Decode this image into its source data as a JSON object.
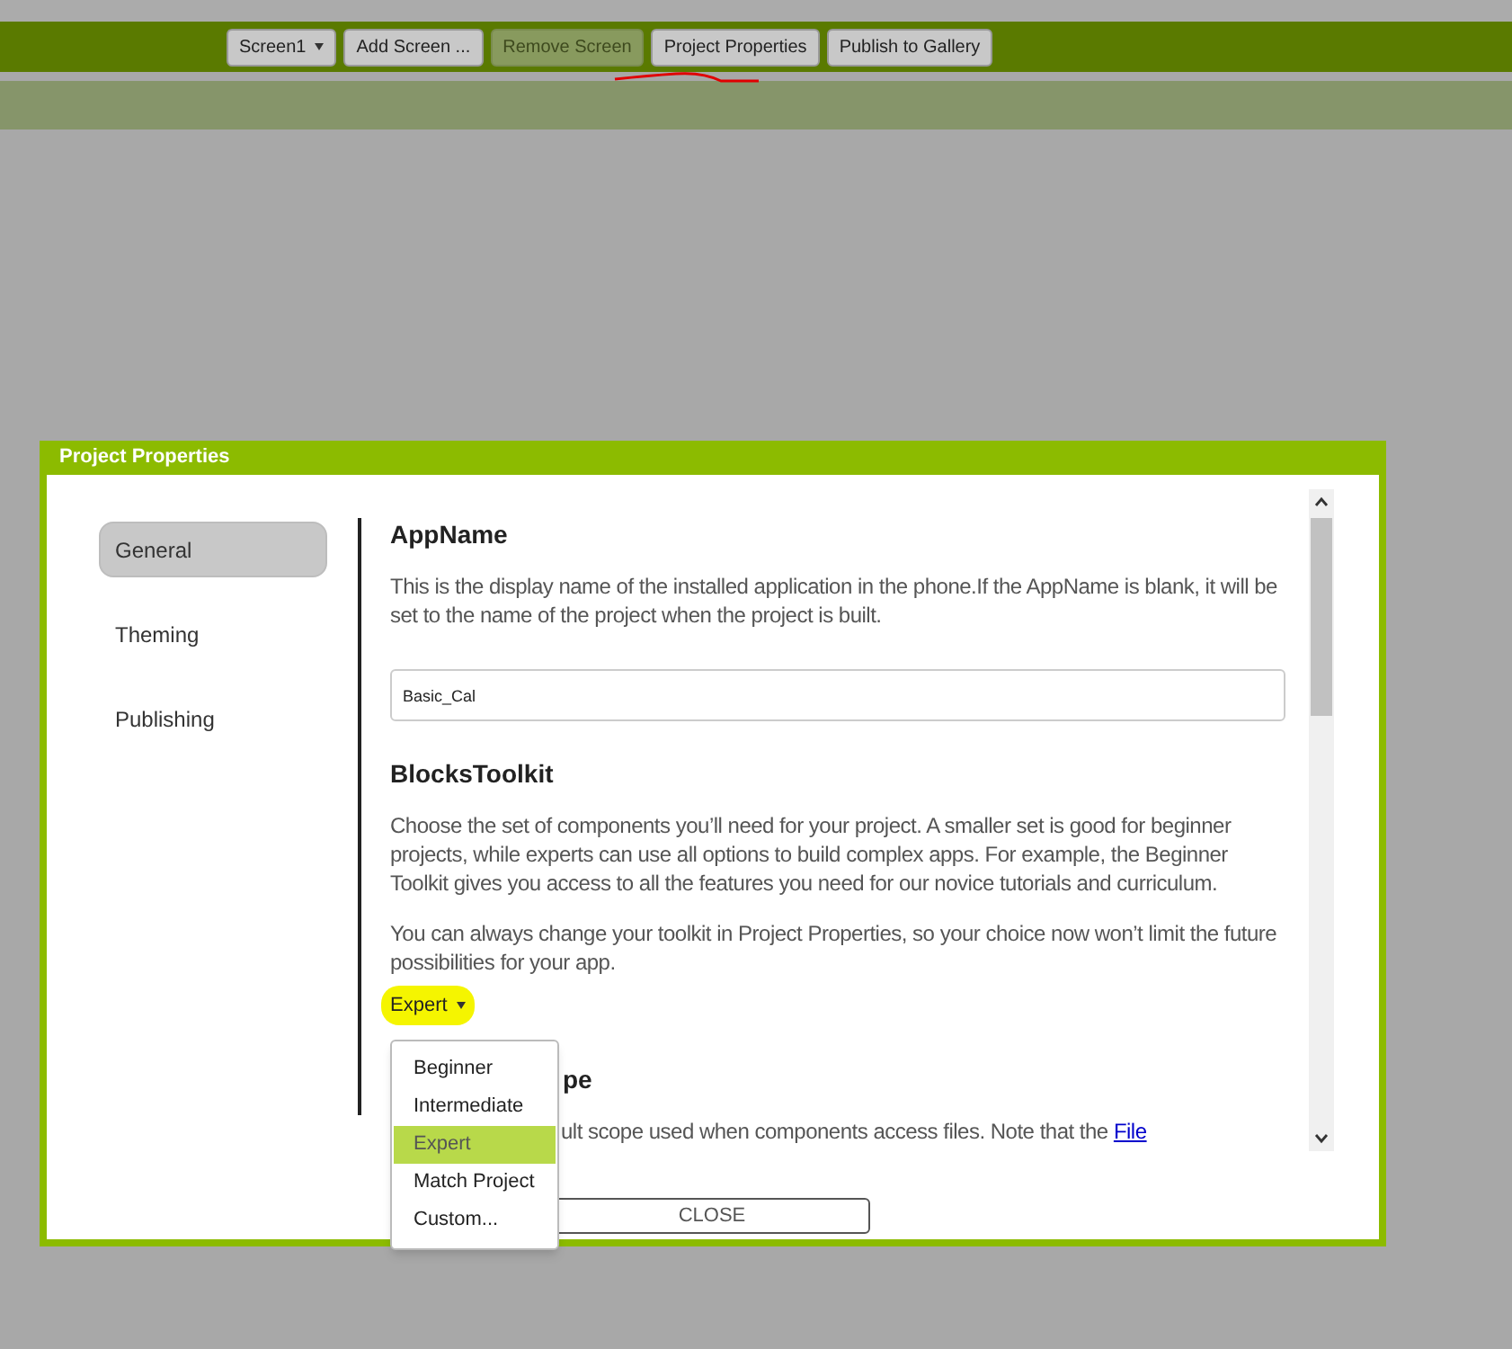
{
  "toolbar": {
    "buttons": [
      {
        "label": "Screen1",
        "kind": "dropdown",
        "disabled": false
      },
      {
        "label": "Add Screen ...",
        "kind": "button",
        "disabled": false
      },
      {
        "label": "Remove Screen",
        "kind": "button",
        "disabled": true
      },
      {
        "label": "Project Properties",
        "kind": "button",
        "disabled": false
      },
      {
        "label": "Publish to Gallery",
        "kind": "button",
        "disabled": false
      }
    ]
  },
  "dialog": {
    "title": "Project Properties",
    "tabs": [
      {
        "label": "General",
        "selected": true
      },
      {
        "label": "Theming",
        "selected": false
      },
      {
        "label": "Publishing",
        "selected": false
      }
    ],
    "sections": [
      {
        "heading": "AppName",
        "paragraphs": [
          {
            "text": "This is the display name of the installed application in the phone.If the AppName is blank, it will be set to the name of the project when the project is built."
          }
        ],
        "field": {
          "value": "Basic_Cal"
        }
      },
      {
        "heading": "BlocksToolkit",
        "paragraphs": [
          {
            "text": "Choose the set of components you’ll need for your project. A smaller set is good for beginner projects, while experts can use all options to build complex apps. For example, the Beginner Toolkit gives you access to all the features you need for our novice tutorials and curriculum."
          },
          {
            "text": "You can always change your toolkit in Project Properties, so your choice now won’t limit the future possibilities for your app."
          }
        ],
        "dropdown": {
          "value": "Expert",
          "highlighted": true
        }
      },
      {
        "heading": "pe",
        "paragraphs": [
          {
            "text": "ult scope used when components access files. Note that the ",
            "link": "File"
          }
        ]
      }
    ],
    "menu": {
      "items": [
        {
          "label": "Beginner",
          "selected": false
        },
        {
          "label": "Intermediate",
          "selected": false
        },
        {
          "label": "Expert",
          "selected": true
        },
        {
          "label": "Match Project",
          "selected": false
        },
        {
          "label": "Custom...",
          "selected": false
        }
      ]
    },
    "close_button": "CLOSE"
  }
}
